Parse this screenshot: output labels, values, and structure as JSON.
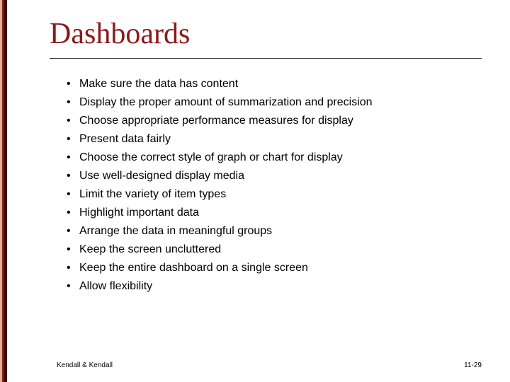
{
  "title": "Dashboards",
  "bullets": [
    "Make sure the data has content",
    "Display the proper amount of summarization and precision",
    "Choose appropriate performance measures for display",
    "Present data fairly",
    "Choose the correct style of graph or chart for display",
    "Use well-designed display media",
    "Limit the variety of item types",
    "Highlight important data",
    "Arrange the data in meaningful groups",
    "Keep the screen uncluttered",
    "Keep the entire dashboard on a single screen",
    "Allow flexibility"
  ],
  "footer": {
    "left": "Kendall & Kendall",
    "right": "11-29"
  }
}
